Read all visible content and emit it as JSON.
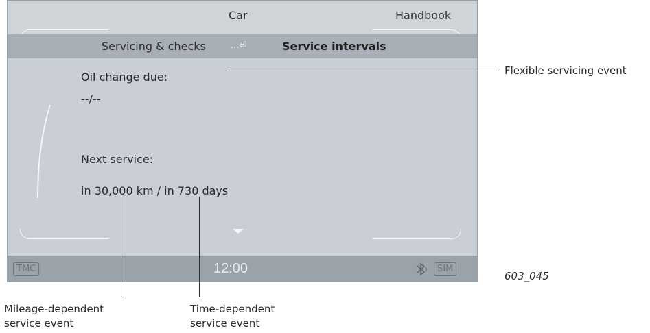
{
  "topbar": {
    "left_item": "Car",
    "right_item": "Handbook"
  },
  "breadcrumb": {
    "parent": "Servicing & checks",
    "back_glyph": "...⏎",
    "current": "Service intervals"
  },
  "oil_change": {
    "label": "Oil change due:",
    "value": "--/--"
  },
  "next_service": {
    "label": "Next service:",
    "value": "in 30,000 km / in 730 days"
  },
  "status": {
    "tmc": "TMC",
    "time": "12:00",
    "sim": "SIM"
  },
  "callouts": {
    "flexible": "Flexible servicing event",
    "mileage_line1": "Mileage-dependent",
    "mileage_line2": "service event",
    "time_line1": "Time-dependent",
    "time_line2": "service event"
  },
  "figure_id": "603_045",
  "icons": {
    "bluetooth": "bluetooth-icon",
    "scroll": "scroll-arc-icon",
    "down": "chevron-down-icon"
  },
  "colors": {
    "screen_bg": "#c9cfd5",
    "crumb_bar": "#a8afb6",
    "status_bar": "#9aa2aa",
    "highlight": "#f4f6f7"
  }
}
